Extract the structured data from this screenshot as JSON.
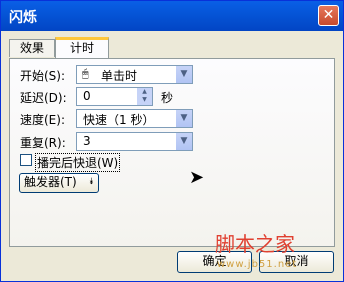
{
  "window": {
    "title": "闪烁",
    "close_glyph": "✕"
  },
  "tabs": [
    {
      "label": "效果"
    },
    {
      "label": "计时"
    }
  ],
  "timing": {
    "start": {
      "label": "开始(S):",
      "value": "单击时"
    },
    "delay": {
      "label": "延迟(D):",
      "value": "0",
      "unit": "秒"
    },
    "speed": {
      "label": "速度(E):",
      "value": "快速（1 秒）"
    },
    "repeat": {
      "label": "重复(R):",
      "value": "3"
    },
    "rewind": {
      "label": "播完后快退(W)",
      "checked": false
    },
    "triggers": {
      "label": "触发器(T)"
    }
  },
  "buttons": {
    "ok": "确定",
    "cancel": "取消"
  },
  "watermark": {
    "brand": "脚本之家",
    "url": "www.jb51.net"
  }
}
